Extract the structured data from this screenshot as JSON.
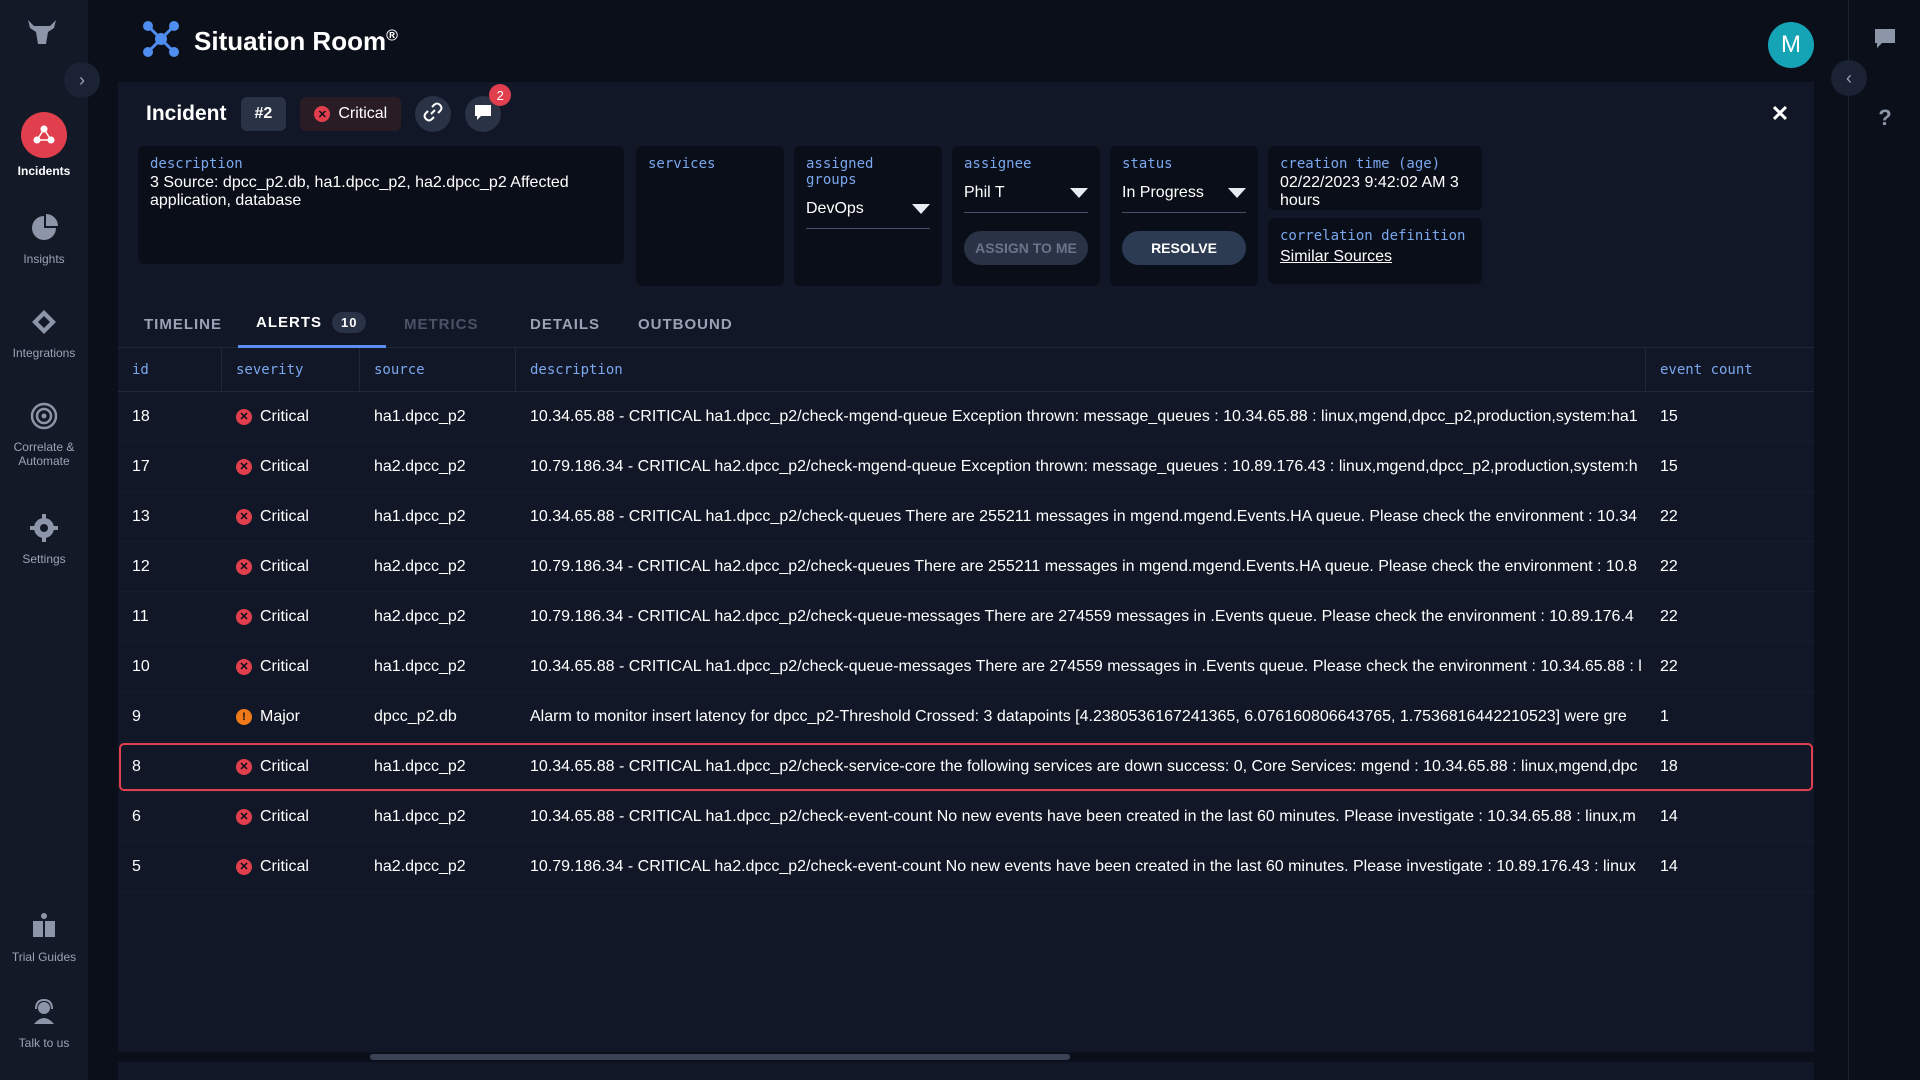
{
  "app": {
    "title": "Situation Room",
    "trademark": "®"
  },
  "user": {
    "avatar_initial": "M"
  },
  "nav": {
    "items": [
      {
        "label": "Incidents",
        "icon": "incidents-icon",
        "active": true
      },
      {
        "label": "Insights",
        "icon": "pie-chart-icon",
        "active": false
      },
      {
        "label": "Integrations",
        "icon": "integrations-icon",
        "active": false
      },
      {
        "label": "Correlate &",
        "label2": "Automate",
        "icon": "target-icon",
        "active": false
      },
      {
        "label": "Settings",
        "icon": "gear-icon",
        "active": false
      },
      {
        "label": "Trial Guides",
        "icon": "book-icon",
        "active": false
      },
      {
        "label": "Talk to us",
        "icon": "support-icon",
        "active": false
      }
    ]
  },
  "incident": {
    "label": "Incident",
    "number": "#2",
    "severity": "Critical",
    "comment_count": "2",
    "fields": {
      "description_label": "description",
      "description_value": "3 Source: dpcc_p2.db, ha1.dpcc_p2, ha2.dpcc_p2 Affected application, database",
      "services_label": "services",
      "groups_label": "assigned groups",
      "groups_value": "DevOps",
      "assignee_label": "assignee",
      "assignee_value": "Phil T",
      "assign_to_me": "ASSIGN TO ME",
      "status_label": "status",
      "status_value": "In Progress",
      "resolve": "RESOLVE",
      "creation_label": "creation time (age)",
      "creation_value": "02/22/2023 9:42:02 AM 3 hours",
      "correlation_label": "correlation definition",
      "correlation_value": "Similar Sources"
    }
  },
  "tabs": [
    {
      "label": "TIMELINE",
      "state": "normal"
    },
    {
      "label": "ALERTS",
      "state": "active",
      "count": "10"
    },
    {
      "label": "METRICS",
      "state": "disabled"
    },
    {
      "label": "DETAILS",
      "state": "normal"
    },
    {
      "label": "OUTBOUND",
      "state": "normal"
    }
  ],
  "table": {
    "columns": [
      "id",
      "severity",
      "source",
      "description",
      "event count"
    ],
    "rows": [
      {
        "id": "18",
        "severity": "Critical",
        "source": "ha1.dpcc_p2",
        "description": "10.34.65.88 - CRITICAL ha1.dpcc_p2/check-mgend-queue Exception thrown: message_queues : 10.34.65.88 : linux,mgend,dpcc_p2,production,system:ha1",
        "count": "15"
      },
      {
        "id": "17",
        "severity": "Critical",
        "source": "ha2.dpcc_p2",
        "description": "10.79.186.34 - CRITICAL ha2.dpcc_p2/check-mgend-queue Exception thrown: message_queues : 10.89.176.43 : linux,mgend,dpcc_p2,production,system:h",
        "count": "15"
      },
      {
        "id": "13",
        "severity": "Critical",
        "source": "ha1.dpcc_p2",
        "description": "10.34.65.88 - CRITICAL ha1.dpcc_p2/check-queues There are 255211 messages in mgend.mgend.Events.HA queue. Please check the environment : 10.34",
        "count": "22"
      },
      {
        "id": "12",
        "severity": "Critical",
        "source": "ha2.dpcc_p2",
        "description": "10.79.186.34 - CRITICAL ha2.dpcc_p2/check-queues There are 255211 messages in mgend.mgend.Events.HA queue. Please check the environment : 10.8",
        "count": "22"
      },
      {
        "id": "11",
        "severity": "Critical",
        "source": "ha2.dpcc_p2",
        "description": "10.79.186.34 - CRITICAL ha2.dpcc_p2/check-queue-messages There are 274559 messages in .Events queue. Please check the environment : 10.89.176.4",
        "count": "22"
      },
      {
        "id": "10",
        "severity": "Critical",
        "source": "ha1.dpcc_p2",
        "description": "10.34.65.88 - CRITICAL ha1.dpcc_p2/check-queue-messages There are 274559 messages in .Events queue. Please check the environment : 10.34.65.88 : l",
        "count": "22"
      },
      {
        "id": "9",
        "severity": "Major",
        "source": "dpcc_p2.db",
        "description": "Alarm to monitor insert latency for dpcc_p2-Threshold Crossed: 3 datapoints [4.2380536167241365, 6.076160806643765, 1.7536816442210523] were gre",
        "count": "1"
      },
      {
        "id": "8",
        "severity": "Critical",
        "source": "ha1.dpcc_p2",
        "description": "10.34.65.88 - CRITICAL ha1.dpcc_p2/check-service-core the following services are down success: 0, Core Services: mgend : 10.34.65.88 : linux,mgend,dpc",
        "count": "18"
      },
      {
        "id": "6",
        "severity": "Critical",
        "source": "ha1.dpcc_p2",
        "description": "10.34.65.88 - CRITICAL ha1.dpcc_p2/check-event-count No new events have been created in the last 60 minutes. Please investigate : 10.34.65.88 : linux,m",
        "count": "14"
      },
      {
        "id": "5",
        "severity": "Critical",
        "source": "ha2.dpcc_p2",
        "description": "10.79.186.34 - CRITICAL ha2.dpcc_p2/check-event-count No new events have been created in the last 60 minutes. Please investigate : 10.89.176.43 : linux",
        "count": "14"
      }
    ]
  },
  "colors": {
    "critical": "#e23f4e",
    "major": "#f07a1a",
    "accent": "#7aa7ee",
    "highlight": "#e23f4e"
  }
}
